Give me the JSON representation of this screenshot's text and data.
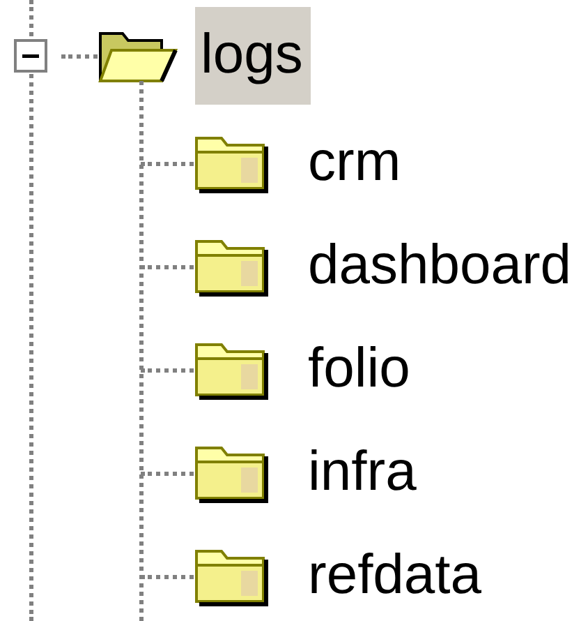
{
  "tree": {
    "label": "logs",
    "expanded": true,
    "selected": true,
    "children": [
      {
        "label": "crm",
        "selected": false
      },
      {
        "label": "dashboard",
        "selected": false
      },
      {
        "label": "folio",
        "selected": false
      },
      {
        "label": "infra",
        "selected": false
      },
      {
        "label": "refdata",
        "selected": false
      }
    ]
  }
}
